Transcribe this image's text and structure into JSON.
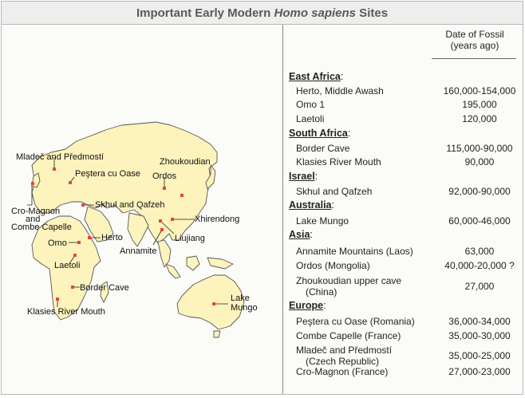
{
  "title": {
    "pre": "Important Early Modern ",
    "italic": "Homo sapiens",
    "post": " Sites"
  },
  "table_header": {
    "line1": "Date of Fossil",
    "line2": "(years ago)"
  },
  "regions": [
    {
      "name": "East Africa",
      "suffix": ":",
      "sites": [
        {
          "site": "Herto, Middle Awash",
          "date": "160,000-154,000"
        },
        {
          "site": "Omo 1",
          "date": "195,000"
        },
        {
          "site": "Laetoli",
          "date": "120,000"
        }
      ]
    },
    {
      "name": "South Africa",
      "suffix": ":",
      "sites": [
        {
          "site": "Border Cave",
          "date": "115,000-90,000"
        },
        {
          "site": "Klasies River Mouth",
          "date": "90,000"
        }
      ]
    },
    {
      "name": "Israel",
      "suffix": ":",
      "sites": [
        {
          "site": "Skhul and Qafzeh",
          "date": "92,000-90,000"
        }
      ]
    },
    {
      "name": "Australia",
      "suffix": ":",
      "sites": [
        {
          "site": "Lake Mungo",
          "date": "60,000-46,000"
        }
      ]
    },
    {
      "name": "Asia",
      "suffix": ":",
      "sites": [
        {
          "site": "Annamite Mountains (Laos)",
          "date": "63,000"
        },
        {
          "site": "Ordos (Mongolia)",
          "date": "40,000-20,000 ?"
        },
        {
          "site": "Zhoukoudian upper cave",
          "site2": "(China)",
          "date": "27,000"
        }
      ]
    },
    {
      "name": "Europe",
      "suffix": ":",
      "sites": [
        {
          "site": "Peştera cu Oase (Romania)",
          "date": "36,000-34,000"
        },
        {
          "site": "Combe Capelle (France)",
          "date": "35,000-30,000"
        },
        {
          "site": "Mladeč and Předmostí",
          "site2": "(Czech Republic)",
          "date": "35,000-25,000"
        },
        {
          "site": "Cro-Magnon (France)",
          "date": "27,000-23,000"
        }
      ]
    }
  ],
  "map_labels": {
    "mladec": "Mladeč and Předmostí",
    "pestera": "Peştera cu Oase",
    "zhoukoudian": "Zhoukoudian",
    "ordos": "Ordos",
    "cromagnon_1": "Cro-Magnon",
    "cromagnon_2": "and",
    "cromagnon_3": "Combe Capelle",
    "skhul": "Skhul and Qafzeh",
    "xhirendong": "Xhirendong",
    "liujiang": "Liujiang",
    "annamite": "Annamite",
    "herto": "Herto",
    "omo": "Omo",
    "laetoli": "Laetoli",
    "border_cave": "Border Cave",
    "klasies": "Klasies River Mouth",
    "lake": "Lake",
    "mungo": "Mungo"
  },
  "colors": {
    "land": "#fdf3bd",
    "coast": "#555555",
    "marker": "#e8443a"
  }
}
